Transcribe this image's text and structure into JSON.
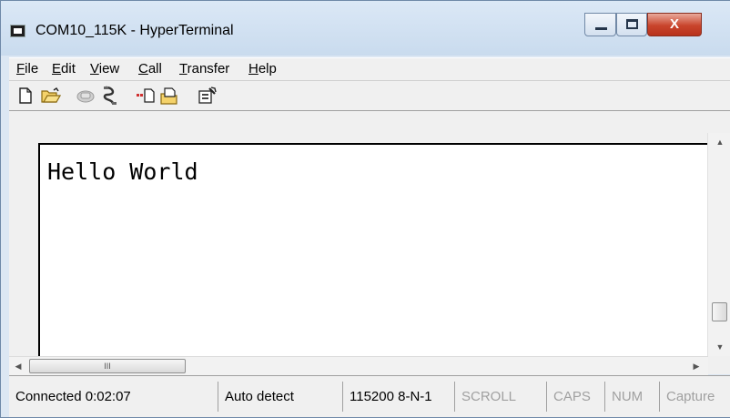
{
  "window": {
    "title": "COM10_115K - HyperTerminal"
  },
  "caption_buttons": {
    "minimize_icon": "minimize-icon",
    "maximize_icon": "maximize-icon",
    "close_glyph": "X"
  },
  "menu": [
    {
      "label_u": "F",
      "label_rest": "ile"
    },
    {
      "label_u": "E",
      "label_rest": "dit"
    },
    {
      "label_u": "V",
      "label_rest": "iew"
    },
    {
      "label_u": "C",
      "label_rest": "all"
    },
    {
      "label_u": "T",
      "label_rest": "ransfer"
    },
    {
      "label_u": "H",
      "label_rest": "elp"
    }
  ],
  "toolbar": [
    "new-icon",
    "open-icon",
    "connect-icon",
    "disconnect-icon",
    "send-icon",
    "receive-icon",
    "properties-icon"
  ],
  "terminal": {
    "text": "Hello World"
  },
  "hscroll": {
    "thumb_grip": "III"
  },
  "status": {
    "connected": "Connected 0:02:07",
    "detect": "Auto detect",
    "settings": "115200 8-N-1",
    "scroll": "SCROLL",
    "caps": "CAPS",
    "num": "NUM",
    "capture": "Capture"
  },
  "colors": {
    "close_button": "#c9442c",
    "title_bar": "#d5e4f3",
    "disabled_text": "#a0a0a0"
  }
}
